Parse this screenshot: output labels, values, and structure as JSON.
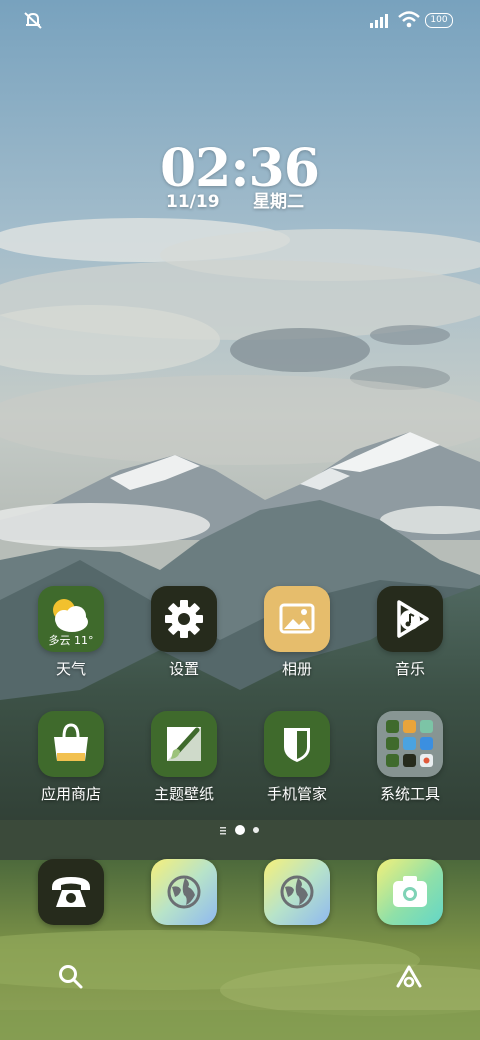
{
  "status_bar": {
    "left_icon": "mute-bell-icon",
    "signal_icon": "cellular-signal-icon",
    "wifi_icon": "wifi-icon",
    "battery_level": "100"
  },
  "clock": {
    "time": "02:36",
    "date": "11/19",
    "weekday": "星期二"
  },
  "apps_row1": [
    {
      "label": "天气",
      "icon": "weather-icon",
      "weather_text": "多云 11°"
    },
    {
      "label": "设置",
      "icon": "gear-icon"
    },
    {
      "label": "相册",
      "icon": "gallery-icon"
    },
    {
      "label": "音乐",
      "icon": "music-play-icon"
    }
  ],
  "apps_row2": [
    {
      "label": "应用商店",
      "icon": "shopping-bag-icon"
    },
    {
      "label": "主题壁纸",
      "icon": "paintbrush-icon"
    },
    {
      "label": "手机管家",
      "icon": "shield-icon"
    },
    {
      "label": "系统工具",
      "icon": "folder-grid-icon"
    }
  ],
  "dock": [
    {
      "icon": "phone-icon"
    },
    {
      "icon": "browser-globe-icon"
    },
    {
      "icon": "browser-globe-icon"
    },
    {
      "icon": "camera-icon"
    }
  ],
  "nav": {
    "left_icon": "search-icon",
    "right_icon": "assistant-icon"
  },
  "colors": {
    "app_green": "#3f6a2c",
    "app_dark": "#262b1c",
    "gallery_yellow": "#e6bd6c",
    "sky_top": "#7fa7c2",
    "mountain_dark": "#41535a",
    "meadow_green": "#6d8a42"
  }
}
